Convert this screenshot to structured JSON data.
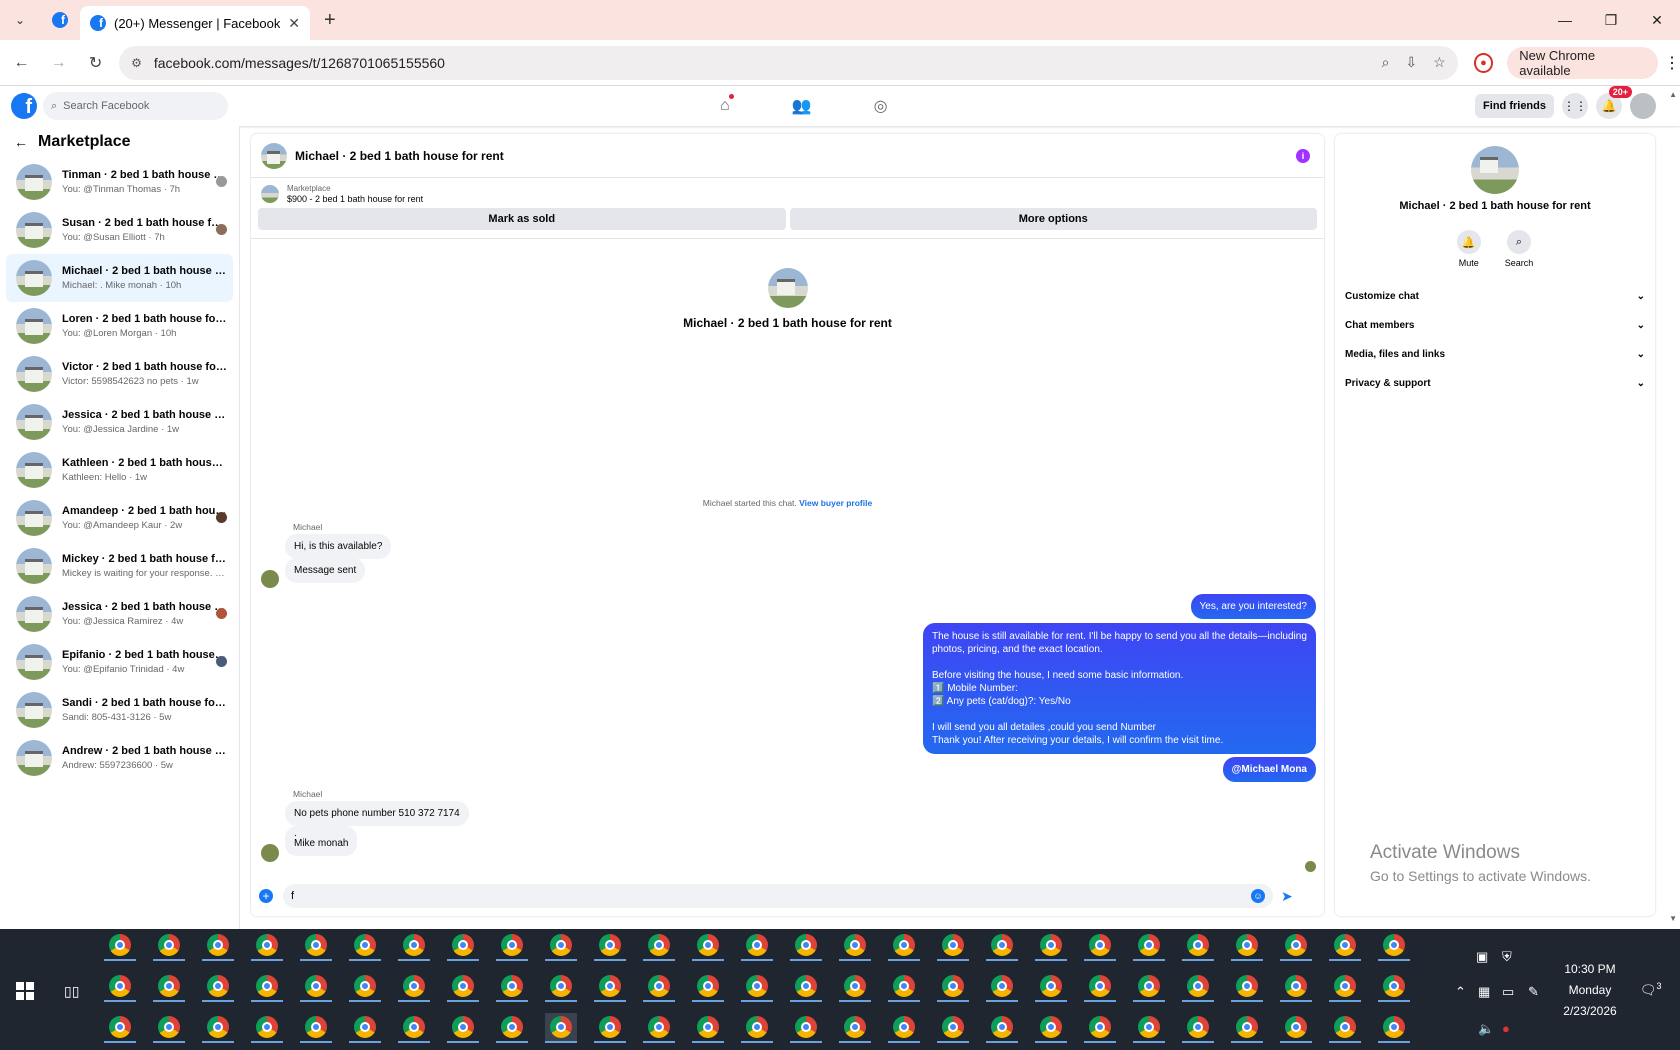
{
  "browser": {
    "tab_title": "(20+) Messenger | Facebook",
    "url": "facebook.com/messages/t/1268701065155560",
    "new_chrome": "New Chrome available"
  },
  "fb": {
    "search_placeholder": "Search Facebook",
    "find_friends": "Find friends",
    "notif_badge": "20+"
  },
  "sidebar": {
    "title": "Marketplace",
    "items": [
      {
        "name": "Tinman · 2 bed 1 bath house for ...",
        "sub": "You: @Tinman Thomas · 7h"
      },
      {
        "name": "Susan · 2 bed 1 bath house for r...",
        "sub": "You: @Susan Elliott · 7h"
      },
      {
        "name": "Michael · 2 bed 1 bath house for re...",
        "sub": "Michael: . Mike monah · 10h"
      },
      {
        "name": "Loren · 2 bed 1 bath house for rent",
        "sub": "You: @Loren Morgan · 10h"
      },
      {
        "name": "Victor · 2 bed 1 bath house for rent",
        "sub": "Victor: 5598542623 no pets · 1w"
      },
      {
        "name": "Jessica · 2 bed 1 bath house for rent",
        "sub": "You: @Jessica Jardine · 1w"
      },
      {
        "name": "Kathleen · 2 bed 1 bath house for r...",
        "sub": "Kathleen: Hello · 1w"
      },
      {
        "name": "Amandeep · 2 bed 1 bath house ...",
        "sub": "You: @Amandeep Kaur · 2w"
      },
      {
        "name": "Mickey · 2 bed 1 bath house for rent",
        "sub": "Mickey is waiting for your response. · 4w"
      },
      {
        "name": "Jessica · 2 bed 1 bath house for r...",
        "sub": "You: @Jessica Ramirez · 4w"
      },
      {
        "name": "Epifanio · 2 bed 1 bath house for...",
        "sub": "You: @Epifanio Trinidad · 4w"
      },
      {
        "name": "Sandi · 2 bed 1 bath house for rent",
        "sub": "Sandi: 805-431-3126 · 5w"
      },
      {
        "name": "Andrew · 2 bed 1 bath house for re...",
        "sub": "Andrew: 5597236600 · 5w"
      }
    ]
  },
  "chat": {
    "title": "Michael · 2 bed 1 bath house for rent",
    "mp_label": "Marketplace",
    "mp_listing": "$900 - 2 bed 1 bath house for rent",
    "mark_sold": "Mark as sold",
    "more_options": "More options",
    "card_name": "Michael · 2 bed 1 bath house for rent",
    "started": "Michael started this chat.",
    "view_profile": "View buyer profile",
    "sender": "Michael",
    "m1": "Hi, is this available?",
    "m2": "Message sent",
    "r1": "Yes, are you interested?",
    "r2_l1": "The house is still available for rent. I'll be happy to send you all the details—including",
    "r2_l2": "photos, pricing, and the exact location.",
    "r2_l3": "Before visiting the house, I need some basic information.",
    "r2_l4": "1️⃣  Mobile Number:",
    "r2_l5": "2️⃣ Any pets (cat/dog)?: Yes/No",
    "r2_l6": "I will send you all detailes ,could you send Number",
    "r2_l7": "Thank you! After receiving your details, I will confirm the visit time.",
    "r3": "@Michael Mona",
    "m3": "No pets phone number 510 372 7174",
    "m4_a": ".",
    "m4_b": "Mike monah",
    "input_value": "f"
  },
  "details": {
    "name": "Michael · 2 bed 1 bath house for rent",
    "mute": "Mute",
    "search": "Search",
    "sections": [
      "Customize chat",
      "Chat members",
      "Media, files and links",
      "Privacy & support"
    ]
  },
  "watermark": {
    "line1": "Activate Windows",
    "line2": "Go to Settings to activate Windows."
  },
  "clock": {
    "time": "10:30 PM",
    "day": "Monday",
    "date": "2/23/2026",
    "notif_count": "3"
  }
}
